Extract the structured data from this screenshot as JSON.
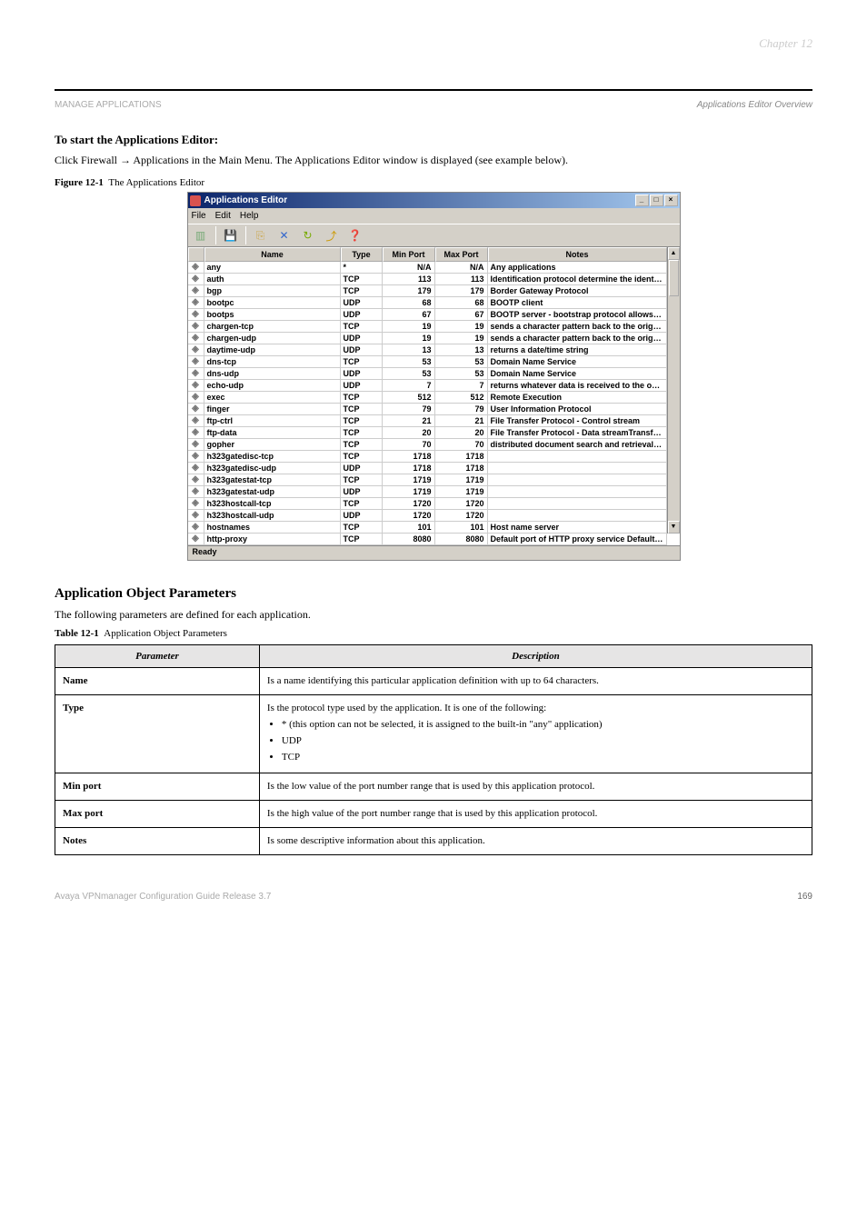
{
  "chapter_num": "Chapter 12",
  "breadcrumb_left": "MANAGE APPLICATIONS",
  "breadcrumb_right": "Applications Editor Overview",
  "intro_heading": "To start the Applications Editor:",
  "intro_text": "Click Firewall → Applications in the Main Menu. The Applications Editor window is displayed (see example below).",
  "figure_label": "Figure 12-1",
  "figure_title": "The Applications Editor",
  "window": {
    "title": "Applications Editor",
    "menus": [
      "File",
      "Edit",
      "Help"
    ],
    "columns": [
      "",
      "Name",
      "Type",
      "Min Port",
      "Max Port",
      "Notes"
    ],
    "status": "Ready",
    "rows": [
      {
        "name": "any",
        "type": "*",
        "min": "N/A",
        "max": "N/A",
        "notes": "Any applications"
      },
      {
        "name": "auth",
        "type": "TCP",
        "min": "113",
        "max": "113",
        "notes": "Identification protocol determine the identity of a user of a partic..."
      },
      {
        "name": "bgp",
        "type": "TCP",
        "min": "179",
        "max": "179",
        "notes": "Border Gateway Protocol"
      },
      {
        "name": "bootpc",
        "type": "UDP",
        "min": "68",
        "max": "68",
        "notes": "BOOTP client"
      },
      {
        "name": "bootps",
        "type": "UDP",
        "min": "67",
        "max": "67",
        "notes": "BOOTP server - bootstrap protocol allows a diskless client machi..."
      },
      {
        "name": "chargen-tcp",
        "type": "TCP",
        "min": "19",
        "max": "19",
        "notes": "sends a character pattern back to the originating source"
      },
      {
        "name": "chargen-udp",
        "type": "UDP",
        "min": "19",
        "max": "19",
        "notes": "sends a character pattern back to the originating source"
      },
      {
        "name": "daytime-udp",
        "type": "UDP",
        "min": "13",
        "max": "13",
        "notes": "returns a date/time string"
      },
      {
        "name": "dns-tcp",
        "type": "TCP",
        "min": "53",
        "max": "53",
        "notes": "Domain Name Service"
      },
      {
        "name": "dns-udp",
        "type": "UDP",
        "min": "53",
        "max": "53",
        "notes": "Domain Name Service"
      },
      {
        "name": "echo-udp",
        "type": "UDP",
        "min": "7",
        "max": "7",
        "notes": "returns whatever data is received to the originating source, used..."
      },
      {
        "name": "exec",
        "type": "TCP",
        "min": "512",
        "max": "512",
        "notes": "Remote Execution"
      },
      {
        "name": "finger",
        "type": "TCP",
        "min": "79",
        "max": "79",
        "notes": "User Information Protocol"
      },
      {
        "name": "ftp-ctrl",
        "type": "TCP",
        "min": "21",
        "max": "21",
        "notes": "File Transfer Protocol - Control stream"
      },
      {
        "name": "ftp-data",
        "type": "TCP",
        "min": "20",
        "max": "20",
        "notes": "File Transfer Protocol - Data streamTransfer files"
      },
      {
        "name": "gopher",
        "type": "TCP",
        "min": "70",
        "max": "70",
        "notes": "distributed document search and retrieval protocol"
      },
      {
        "name": "h323gatedisc-tcp",
        "type": "TCP",
        "min": "1718",
        "max": "1718",
        "notes": ""
      },
      {
        "name": "h323gatedisc-udp",
        "type": "UDP",
        "min": "1718",
        "max": "1718",
        "notes": ""
      },
      {
        "name": "h323gatestat-tcp",
        "type": "TCP",
        "min": "1719",
        "max": "1719",
        "notes": ""
      },
      {
        "name": "h323gatestat-udp",
        "type": "UDP",
        "min": "1719",
        "max": "1719",
        "notes": ""
      },
      {
        "name": "h323hostcall-tcp",
        "type": "TCP",
        "min": "1720",
        "max": "1720",
        "notes": ""
      },
      {
        "name": "h323hostcall-udp",
        "type": "UDP",
        "min": "1720",
        "max": "1720",
        "notes": ""
      },
      {
        "name": "hostnames",
        "type": "TCP",
        "min": "101",
        "max": "101",
        "notes": "Host name server"
      },
      {
        "name": "http-proxy",
        "type": "TCP",
        "min": "8080",
        "max": "8080",
        "notes": "Default port of HTTP proxy service Default proxy port"
      }
    ]
  },
  "section_heading": "Application Object Parameters",
  "section_text": "The following parameters are defined for each application.",
  "table_label": "Table 12-1",
  "table_title": "Application Object Parameters",
  "params_head": [
    "Parameter",
    "Description"
  ],
  "params": [
    {
      "p": "Name",
      "d": "Is a name identifying this particular application definition with up to 64 characters."
    },
    {
      "p": "Type",
      "d": "",
      "list": [
        "* (this option can not be selected, it is assigned to the built-in \"any\" application)",
        "UDP",
        "TCP"
      ]
    },
    {
      "p": "Type_lead",
      "d": "Is the protocol type used by the application. It is one of the following:"
    },
    {
      "p": "Min port",
      "d": "Is the low value of the port number range that is used by this application protocol."
    },
    {
      "p": "Max port",
      "d": "Is the high value of the port number range that is used by this application protocol."
    },
    {
      "p": "Notes",
      "d": "Is some descriptive information about this application."
    }
  ],
  "footer_prod": "Avaya VPNmanager Configuration Guide Release 3.7",
  "footer_page": "169"
}
